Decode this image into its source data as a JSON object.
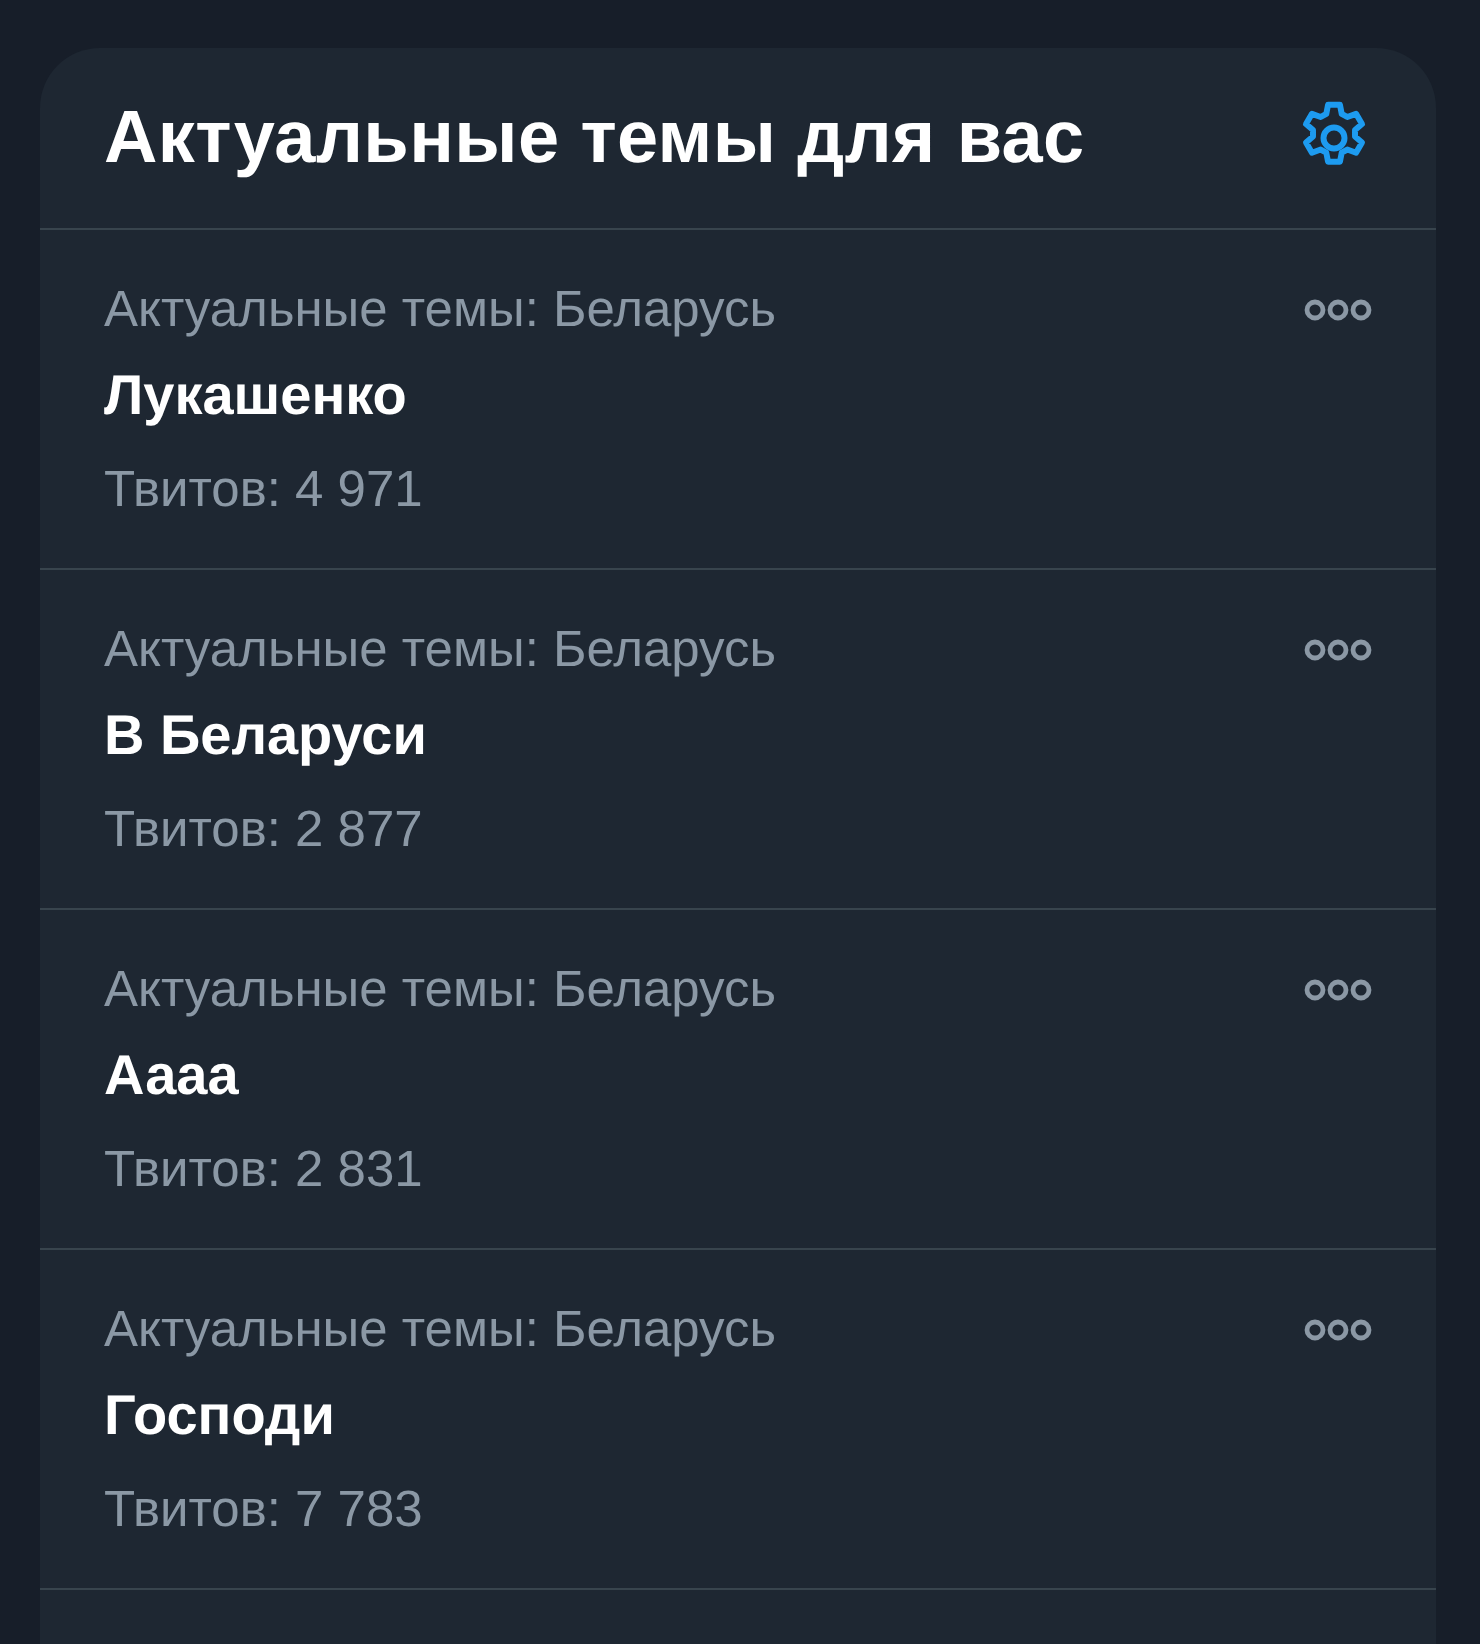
{
  "header": {
    "title": "Актуальные темы для вас"
  },
  "trends": [
    {
      "context": "Актуальные темы: Беларусь",
      "name": "Лукашенко",
      "count": "Твитов: 4 971"
    },
    {
      "context": "Актуальные темы: Беларусь",
      "name": "В Беларуси",
      "count": "Твитов: 2 877"
    },
    {
      "context": "Актуальные темы: Беларусь",
      "name": "Аааа",
      "count": "Твитов: 2 831"
    },
    {
      "context": "Актуальные темы: Беларусь",
      "name": "Господи",
      "count": "Твитов: 7 783"
    }
  ]
}
